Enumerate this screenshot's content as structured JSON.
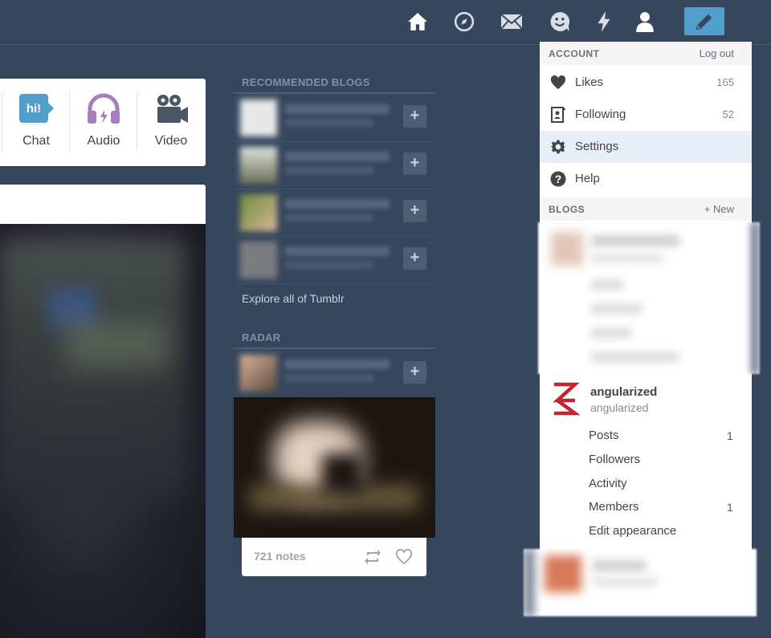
{
  "colors": {
    "background": "#36465d",
    "compose_button": "#529ecc",
    "chat_icon": "#529ecc",
    "audio_icon": "#a77dc2",
    "blog_logo": "#c0282f"
  },
  "topbar": {
    "icons": [
      "home-icon",
      "explore-icon",
      "inbox-icon",
      "messaging-icon",
      "activity-icon",
      "account-icon",
      "compose-icon"
    ]
  },
  "post_types": [
    {
      "label": "Chat",
      "icon": "chat-icon",
      "icon_text": "hi!"
    },
    {
      "label": "Audio",
      "icon": "headphones-icon"
    },
    {
      "label": "Video",
      "icon": "video-camera-icon"
    }
  ],
  "recommended": {
    "title": "RECOMMENDED BLOGS",
    "follow_label": "+",
    "explore_label": "Explore all of Tumblr"
  },
  "radar": {
    "title": "RADAR",
    "follow_label": "+",
    "notes": "721 notes"
  },
  "account_menu": {
    "section_title": "ACCOUNT",
    "logout_label": "Log out",
    "items": [
      {
        "label": "Likes",
        "count": "165",
        "icon": "heart-icon"
      },
      {
        "label": "Following",
        "count": "52",
        "icon": "following-icon"
      },
      {
        "label": "Settings",
        "count": "",
        "icon": "gear-icon"
      },
      {
        "label": "Help",
        "count": "",
        "icon": "help-icon"
      }
    ],
    "blogs_title": "BLOGS",
    "new_label": "+ New"
  },
  "blog": {
    "name": "angularized",
    "subtitle": "angularized",
    "items": [
      {
        "label": "Posts",
        "count": "1"
      },
      {
        "label": "Followers",
        "count": ""
      },
      {
        "label": "Activity",
        "count": ""
      },
      {
        "label": "Members",
        "count": "1"
      },
      {
        "label": "Edit appearance",
        "count": ""
      }
    ]
  }
}
